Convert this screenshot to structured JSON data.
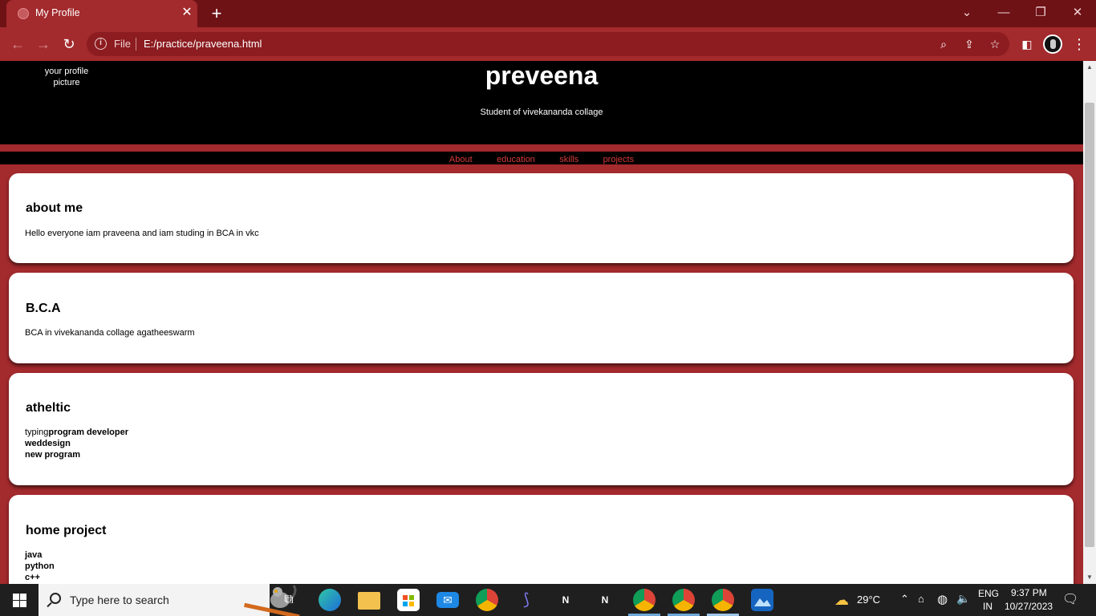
{
  "browser": {
    "tab_title": "My Profile",
    "url_scheme": "File",
    "url": "E:/practice/praveena.html"
  },
  "page": {
    "profile_pic_alt": "your profile picture",
    "name": "preveena",
    "tagline": "Student of vivekananda collage",
    "nav": [
      "About",
      "education",
      "skills",
      "projects"
    ],
    "about": {
      "heading": "about me",
      "text": "Hello everyone iam praveena and iam studing in BCA in vkc"
    },
    "education": {
      "heading": "B.C.A",
      "text": "BCA in vivekananda collage agatheeswarm"
    },
    "skills": {
      "heading": "atheltic",
      "plain": "typing",
      "bold": [
        "program developer",
        "weddesign",
        "new program"
      ]
    },
    "projects": {
      "heading": "home project",
      "items": [
        "java",
        "python",
        "c++"
      ]
    }
  },
  "taskbar": {
    "search_placeholder": "Type here to search",
    "temperature": "29°C",
    "language": "ENG",
    "region": "IN",
    "time": "9:37 PM",
    "date": "10/27/2023",
    "pinned_apps": [
      "task-view-icon",
      "edge-icon",
      "file-explorer-icon",
      "store-icon",
      "mail-icon",
      "chrome-icon",
      "app-s-icon",
      "notion-icon",
      "notion-icon",
      "chrome-profile-icon",
      "chrome-profile-icon",
      "chrome-profile-icon",
      "photos-icon"
    ]
  },
  "colors": {
    "brand_red": "#a32a2d",
    "tab_strip": "#6e1216",
    "nav_link": "#d83a3a"
  }
}
